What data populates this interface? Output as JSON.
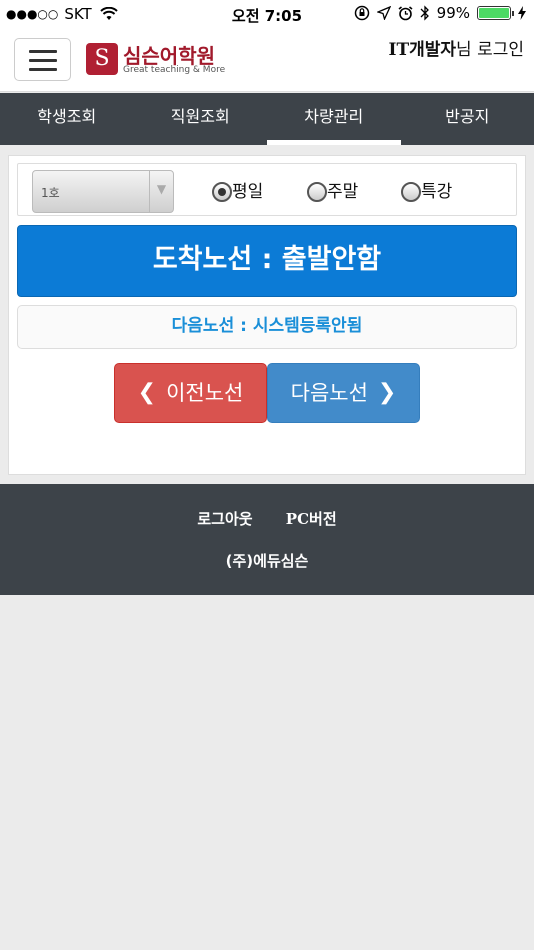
{
  "status_bar": {
    "signal": "●●●○○",
    "carrier": "SKT",
    "time": "오전 7:05",
    "battery": "99%"
  },
  "header": {
    "logo_title": "심슨어학원",
    "logo_subtitle": "Great teaching & More",
    "logo_mark": "S",
    "user_name": "IT개발자",
    "user_suffix": "님 로그인"
  },
  "tabs": [
    {
      "label": "학생조회",
      "active": false
    },
    {
      "label": "직원조회",
      "active": false
    },
    {
      "label": "차량관리",
      "active": true
    },
    {
      "label": "반공지",
      "active": false
    }
  ],
  "filter": {
    "vehicle_select_value": "1호",
    "radios": [
      {
        "label": "평일",
        "checked": true
      },
      {
        "label": "주말",
        "checked": false
      },
      {
        "label": "특강",
        "checked": false
      }
    ]
  },
  "route": {
    "arrival_status": "도착노선 : 출발안함",
    "next_route": "다음노선 : 시스템등록안됨",
    "prev_button": "이전노선",
    "next_button": "다음노선"
  },
  "footer": {
    "logout": "로그아웃",
    "pc_version": "PC버전",
    "company": "(주)에듀심슨"
  },
  "colors": {
    "primary": "#0c7bd6",
    "danger": "#d9534f",
    "info": "#428bca",
    "dark": "#3d4349",
    "brand": "#a1192b"
  }
}
